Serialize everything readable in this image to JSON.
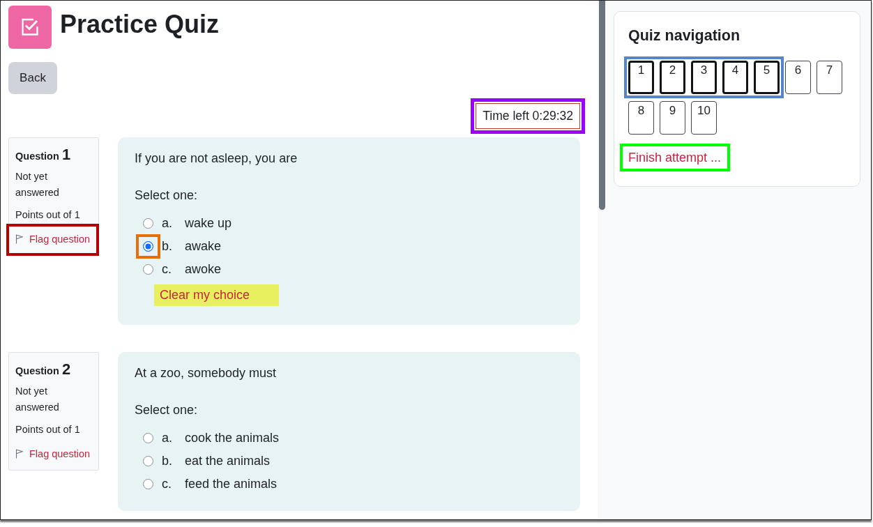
{
  "header": {
    "title": "Practice Quiz"
  },
  "back_button": {
    "label": "Back"
  },
  "timer": {
    "label": "Time left 0:29:32",
    "callout": {
      "color": "#9b00ff"
    }
  },
  "questions": [
    {
      "label": "Question",
      "number": "1",
      "status": "Not yet answered",
      "points": "Points out of 1",
      "flag": {
        "label": "Flag question",
        "callout": {
          "color": "#b50000"
        }
      },
      "text": "If you are not asleep, you are",
      "prompt": "Select one:",
      "options": [
        {
          "letter": "a.",
          "text": "wake up",
          "selected": false
        },
        {
          "letter": "b.",
          "text": "awake",
          "selected": true,
          "callout": {
            "color": "#e5700a"
          }
        },
        {
          "letter": "c.",
          "text": "awoke",
          "selected": false
        }
      ],
      "clear_choice": {
        "label": "Clear my choice",
        "highlight": {
          "color": "#e8f060"
        }
      }
    },
    {
      "label": "Question",
      "number": "2",
      "status": "Not yet answered",
      "points": "Points out of 1",
      "flag": {
        "label": "Flag question"
      },
      "text": "At a zoo, somebody must",
      "prompt": "Select one:",
      "options": [
        {
          "letter": "a.",
          "text": "cook the animals",
          "selected": false
        },
        {
          "letter": "b.",
          "text": "eat the animals",
          "selected": false
        },
        {
          "letter": "c.",
          "text": "feed the animals",
          "selected": false
        }
      ]
    }
  ],
  "navigation": {
    "title": "Quiz navigation",
    "callout": {
      "color": "#5585cc"
    },
    "buttons": [
      {
        "label": "1",
        "selected": true
      },
      {
        "label": "2",
        "selected": true
      },
      {
        "label": "3",
        "selected": true
      },
      {
        "label": "4",
        "selected": true
      },
      {
        "label": "5",
        "selected": true
      },
      {
        "label": "6",
        "selected": false
      },
      {
        "label": "7",
        "selected": false
      },
      {
        "label": "8",
        "selected": false
      },
      {
        "label": "9",
        "selected": false
      },
      {
        "label": "10",
        "selected": false
      }
    ],
    "finish": {
      "label": "Finish attempt ...",
      "callout": {
        "color": "#00ff00"
      }
    }
  }
}
